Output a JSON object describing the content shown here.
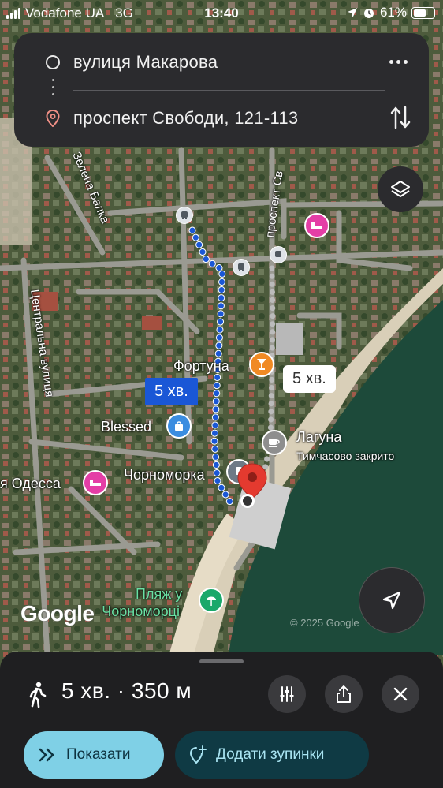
{
  "status_bar": {
    "carrier": "Vodafone UA",
    "network": "3G",
    "time": "13:40",
    "battery": "61%"
  },
  "route": {
    "origin": "вулиця Макарова",
    "destination": "проспект Свободи, 121-113",
    "more_icon": "more-horizontal-icon",
    "swap_icon": "swap-vertical-icon"
  },
  "map": {
    "street_labels": [
      "Зелена Балка",
      "проспект Св",
      "Центральна вулиця"
    ],
    "places": {
      "fortuna": "Фортуна",
      "blessed": "Blessed",
      "laguna": "Лагуна",
      "laguna_status": "Тимчасово закрито",
      "chornomorka": "Чорноморка",
      "odesa": "я Одесса",
      "beach_line1": "Пляж у",
      "beach_line2": "Чорноморці"
    },
    "route_badges": {
      "walk_main": "5 хв.",
      "walk_alt": "5 хв."
    },
    "google_logo": "Google",
    "copyright": "© 2025 Google"
  },
  "bottom_sheet": {
    "summary": "5 хв. · 350 м",
    "show_label": "Показати",
    "add_stops_label": "Додати зупинки"
  },
  "colors": {
    "route_blue": "#1a57d6",
    "accent_cyan": "#7fd0e6",
    "sea": "#1d4a3a",
    "hotel_pink": "#e43ea6",
    "bar_orange": "#f08a24"
  }
}
